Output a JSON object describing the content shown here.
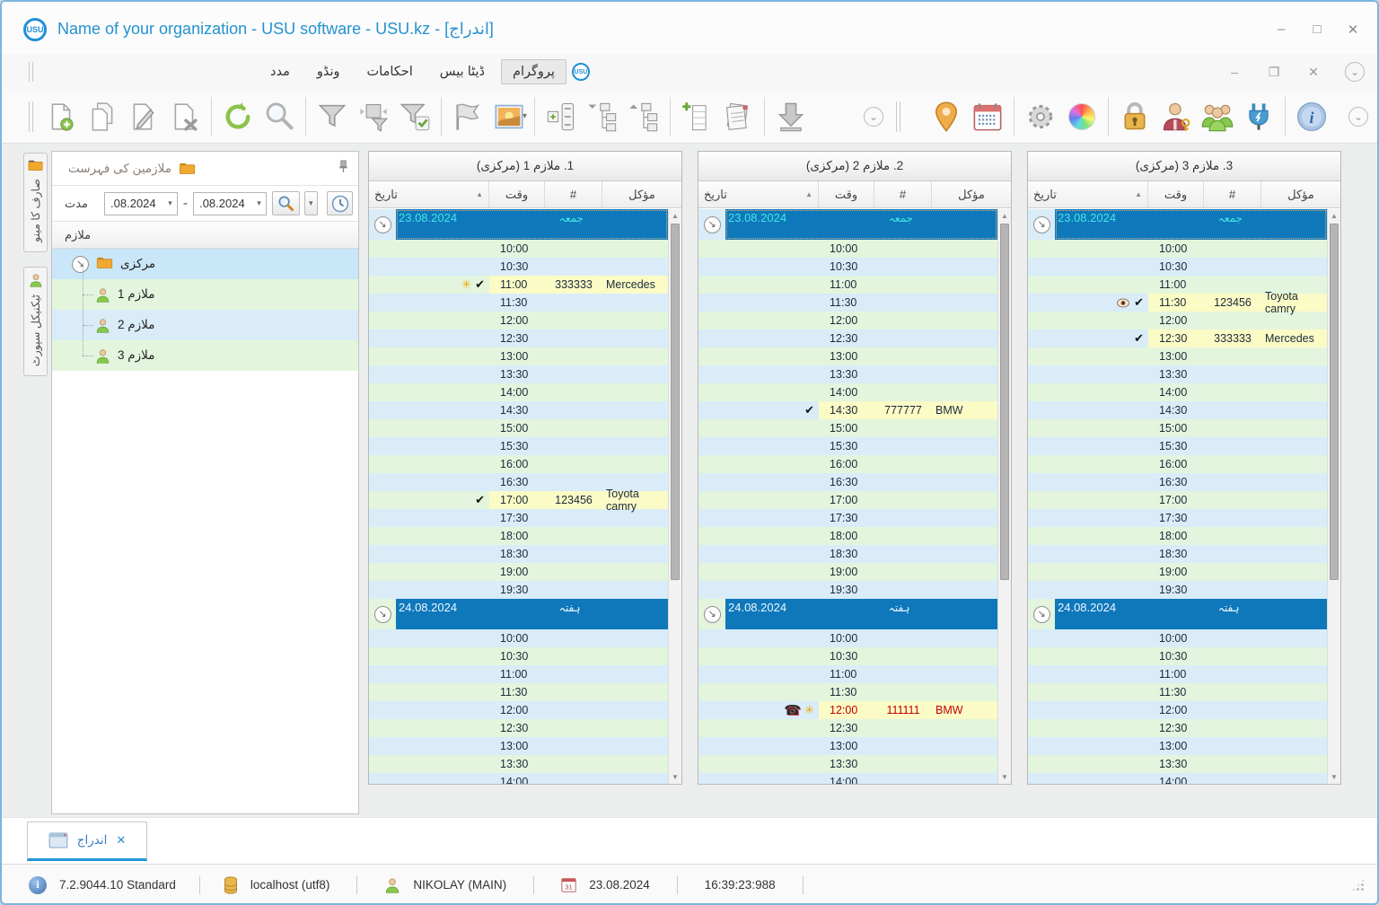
{
  "window": {
    "title": "Name of your organization - USU software - USU.kz - [اندراج]"
  },
  "menu": {
    "items": [
      {
        "label": "مدد",
        "active": false
      },
      {
        "label": "ونڈو",
        "active": false
      },
      {
        "label": "احکامات",
        "active": false
      },
      {
        "label": "ڈیٹا بیس",
        "active": false
      },
      {
        "label": "پروگرام",
        "active": true
      }
    ]
  },
  "toolbar": {
    "left_icon_names": [
      "new-record",
      "copy-record",
      "edit-record",
      "delete-record",
      "refresh",
      "search",
      "filter",
      "filter-panel",
      "filter-check",
      "flag",
      "image-view",
      "expand-groups",
      "collapse-tree",
      "expand-tree",
      "add-column",
      "reports",
      "export",
      "scroll-jump"
    ],
    "right_icon_names": [
      "map-pin",
      "calendar",
      "settings-gear",
      "appearance-wheel",
      "lock",
      "user-permissions",
      "user-groups",
      "integrations-plug",
      "info",
      "scroll-jump"
    ]
  },
  "sidebar": {
    "tabs": [
      {
        "label": "صارف کا مینو"
      },
      {
        "label": "ٹیکنیکل سپورٹ"
      }
    ],
    "panel_title": "ملازمین کی فہرست",
    "period_label": "مدت",
    "date_from": ".08.2024",
    "date_to": ".08.2024",
    "employees_column": "ملازم",
    "tree": {
      "root": "مرکزی",
      "children": [
        "ملازم 1",
        "ملازم 2",
        "ملازم 3"
      ]
    }
  },
  "calendar": {
    "headers": {
      "date": "تاریخ",
      "time": "وقت",
      "number": "#",
      "client": "مؤکل"
    },
    "day1_times": [
      "10:00",
      "10:30",
      "11:00",
      "11:30",
      "12:00",
      "12:30",
      "13:00",
      "13:30",
      "14:00",
      "14:30",
      "15:00",
      "15:30",
      "16:00",
      "16:30",
      "17:00",
      "17:30",
      "18:00",
      "18:30",
      "19:00",
      "19:30"
    ],
    "day2_times": [
      "10:00",
      "10:30",
      "11:00",
      "11:30",
      "12:00",
      "12:30",
      "13:00",
      "13:30",
      "14:00"
    ],
    "panels": [
      {
        "title": "1. ملازم 1 (مرکزی)",
        "days": [
          {
            "date": "23.08.2024",
            "day_name": "جمعہ",
            "selected": true,
            "times_key": "day1_times",
            "appointments": {
              "11:00": {
                "num": "333333",
                "client": "Mercedes",
                "icons": [
                  "star",
                  "check"
                ],
                "alert": false
              },
              "17:00": {
                "num": "123456",
                "client": "Toyota camry",
                "icons": [
                  "check"
                ],
                "alert": false
              }
            }
          },
          {
            "date": "24.08.2024",
            "day_name": "ہفتہ",
            "selected": false,
            "times_key": "day2_times",
            "appointments": {}
          }
        ]
      },
      {
        "title": "2. ملازم 2 (مرکزی)",
        "days": [
          {
            "date": "23.08.2024",
            "day_name": "جمعہ",
            "selected": true,
            "times_key": "day1_times",
            "appointments": {
              "14:30": {
                "num": "777777",
                "client": "BMW",
                "icons": [
                  "check"
                ],
                "alert": false
              }
            }
          },
          {
            "date": "24.08.2024",
            "day_name": "ہفتہ",
            "selected": false,
            "times_key": "day2_times",
            "appointments": {
              "12:00": {
                "num": "111111",
                "client": "BMW",
                "icons": [
                  "phone",
                  "star"
                ],
                "alert": true
              }
            }
          }
        ]
      },
      {
        "title": "3. ملازم 3 (مرکزی)",
        "days": [
          {
            "date": "23.08.2024",
            "day_name": "جمعہ",
            "selected": true,
            "times_key": "day1_times",
            "appointments": {
              "11:30": {
                "num": "123456",
                "client": "Toyota camry",
                "icons": [
                  "eye",
                  "check"
                ],
                "alert": false
              },
              "12:30": {
                "num": "333333",
                "client": "Mercedes",
                "icons": [
                  "check"
                ],
                "alert": false
              }
            }
          },
          {
            "date": "24.08.2024",
            "day_name": "ہفتہ",
            "selected": false,
            "times_key": "day2_times",
            "appointments": {}
          }
        ]
      }
    ]
  },
  "tabbar": {
    "tab": "اندراج"
  },
  "statusbar": {
    "version": "7.2.9044.10 Standard",
    "database": "localhost (utf8)",
    "user": "NIKOLAY (MAIN)",
    "date": "23.08.2024",
    "time": "16:39:23:988"
  },
  "colors": {
    "accent": "#2196d3",
    "band_blue": "#0e78bb",
    "band_text_selected": "#46e3e3",
    "row_green": "#e3f5dd",
    "row_blue": "#d9ecf8",
    "appointment_yellow": "#fbfbc6",
    "alert_red": "#c00000"
  }
}
